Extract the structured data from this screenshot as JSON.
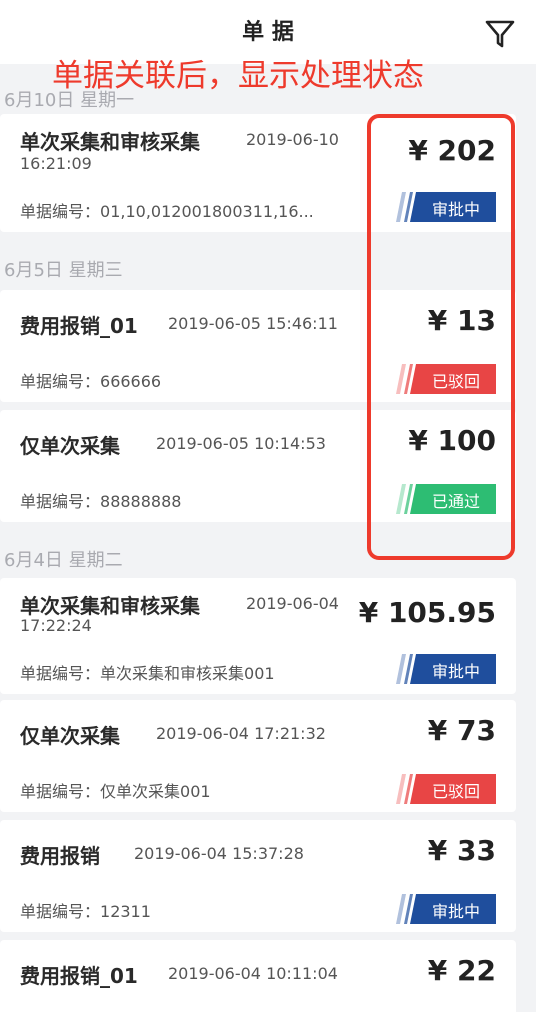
{
  "header": {
    "title": "单 据",
    "annotation": "单据关联后，显示处理状态"
  },
  "colors": {
    "approving": "#1f4e9d",
    "rejected": "#e84545",
    "approved": "#2dbd73",
    "annotation": "#ee3a2c"
  },
  "icons": {
    "filter": "filter-icon",
    "status_stripe": "status-stripe"
  },
  "groups": [
    {
      "date": "6月10日  星期一",
      "items": [
        {
          "title": "单次采集和审核采集",
          "time": "2019-06-10",
          "time2": "16:21:09",
          "code_label": "单据编号：",
          "code": "01,10,012001800311,16...",
          "amount": "¥ 202",
          "status": "审批中"
        }
      ]
    },
    {
      "date": "6月5日  星期三",
      "items": [
        {
          "title": "费用报销_01",
          "time": "2019-06-05 15:46:11",
          "code_label": "单据编号：",
          "code": "666666",
          "amount": "¥ 13",
          "status": "已驳回"
        },
        {
          "title": "仅单次采集",
          "time": "2019-06-05 10:14:53",
          "code_label": "单据编号：",
          "code": "88888888",
          "amount": "¥ 100",
          "status": "已通过"
        }
      ]
    },
    {
      "date": "6月4日  星期二",
      "items": [
        {
          "title": "单次采集和审核采集",
          "time": "2019-06-04",
          "time2": "17:22:24",
          "code_label": "单据编号：",
          "code": "单次采集和审核采集001",
          "amount": "¥ 105.95",
          "status": "审批中"
        },
        {
          "title": "仅单次采集",
          "time": "2019-06-04 17:21:32",
          "code_label": "单据编号：",
          "code": "仅单次采集001",
          "amount": "¥ 73",
          "status": "已驳回"
        },
        {
          "title": "费用报销",
          "time": "2019-06-04 15:37:28",
          "code_label": "单据编号：",
          "code": "12311",
          "amount": "¥ 33",
          "status": "审批中"
        },
        {
          "title": "费用报销_01",
          "time": "2019-06-04 10:11:04",
          "amount": "¥ 22"
        }
      ]
    }
  ]
}
